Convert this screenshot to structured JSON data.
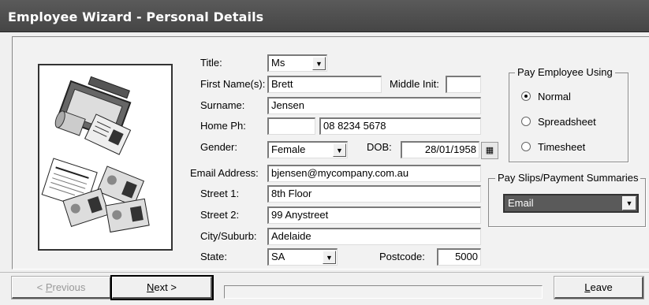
{
  "window": {
    "title": "Employee Wizard - Personal Details"
  },
  "form": {
    "title_label": "Title:",
    "title_value": "Ms",
    "first_name_label": "First Name(s):",
    "first_name": "Brett",
    "middle_init_label": "Middle Init:",
    "middle_init": "",
    "surname_label": "Surname:",
    "surname": "Jensen",
    "home_ph_label": "Home Ph:",
    "home_ph_area": "",
    "home_ph_number": "08 8234 5678",
    "gender_label": "Gender:",
    "gender": "Female",
    "dob_label": "DOB:",
    "dob": "28/01/1958",
    "email_label": "Email Address:",
    "email": "bjensen@mycompany.com.au",
    "street1_label": "Street 1:",
    "street1": "8th Floor",
    "street2_label": "Street 2:",
    "street2": "99 Anystreet",
    "city_label": "City/Suburb:",
    "city": "Adelaide",
    "state_label": "State:",
    "state": "SA",
    "postcode_label": "Postcode:",
    "postcode": "5000"
  },
  "pay_using": {
    "legend": "Pay Employee Using",
    "options": [
      "Normal",
      "Spreadsheet",
      "Timesheet"
    ],
    "selected": "Normal"
  },
  "payslips": {
    "legend": "Pay Slips/Payment Summaries",
    "value": "Email"
  },
  "buttons": {
    "previous_u": "P",
    "previous_rest": "revious",
    "next_u": "N",
    "next_rest": "ext >",
    "leave_u": "L",
    "leave_rest": "eave"
  },
  "icons": {
    "calendar": "calendar-icon",
    "dropdown": "chevron-down-icon",
    "illustration": "employee-documents-illustration"
  }
}
